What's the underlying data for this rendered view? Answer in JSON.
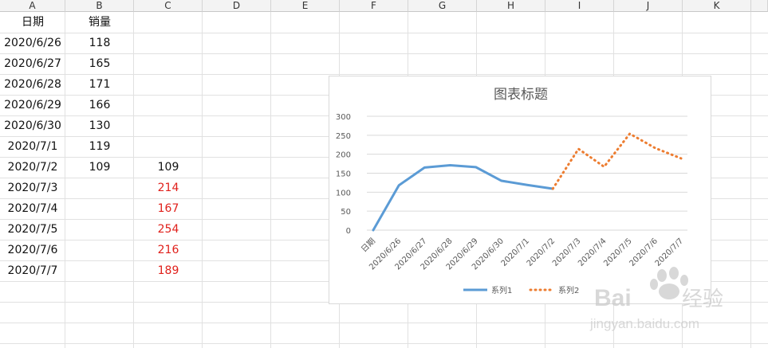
{
  "columns": [
    "A",
    "B",
    "C",
    "D",
    "E",
    "F",
    "G",
    "H",
    "I",
    "J",
    "K"
  ],
  "rows": [
    {
      "a": "日期",
      "b": "销量",
      "c": ""
    },
    {
      "a": "2020/6/26",
      "b": "118",
      "c": ""
    },
    {
      "a": "2020/6/27",
      "b": "165",
      "c": ""
    },
    {
      "a": "2020/6/28",
      "b": "171",
      "c": ""
    },
    {
      "a": "2020/6/29",
      "b": "166",
      "c": ""
    },
    {
      "a": "2020/6/30",
      "b": "130",
      "c": ""
    },
    {
      "a": "2020/7/1",
      "b": "119",
      "c": ""
    },
    {
      "a": "2020/7/2",
      "b": "109",
      "c": "109"
    },
    {
      "a": "2020/7/3",
      "b": "",
      "c": "214"
    },
    {
      "a": "2020/7/4",
      "b": "",
      "c": "167"
    },
    {
      "a": "2020/7/5",
      "b": "",
      "c": "254"
    },
    {
      "a": "2020/7/6",
      "b": "",
      "c": "216"
    },
    {
      "a": "2020/7/7",
      "b": "",
      "c": "189"
    }
  ],
  "colors": {
    "series1": "#5b9bd5",
    "series2": "#ed7d31",
    "red_text": "#e0201b"
  },
  "watermark": {
    "brand": "Bai",
    "brand2": "经验",
    "url": "jingyan.baidu.com"
  },
  "chart_data": {
    "type": "line",
    "title": "图表标题",
    "categories": [
      "日期",
      "2020/6/26",
      "2020/6/27",
      "2020/6/28",
      "2020/6/29",
      "2020/6/30",
      "2020/7/1",
      "2020/7/2",
      "2020/7/3",
      "2020/7/4",
      "2020/7/5",
      "2020/7/6",
      "2020/7/7"
    ],
    "series": [
      {
        "name": "系列1",
        "values": [
          0,
          118,
          165,
          171,
          166,
          130,
          119,
          109,
          null,
          null,
          null,
          null,
          null
        ],
        "style": "solid"
      },
      {
        "name": "系列2",
        "values": [
          null,
          null,
          null,
          null,
          null,
          null,
          null,
          109,
          214,
          167,
          254,
          216,
          189
        ],
        "style": "dotted"
      }
    ],
    "yticks": [
      "0",
      "50",
      "100",
      "150",
      "200",
      "250",
      "300"
    ],
    "ylim": [
      0,
      300
    ],
    "grid": true,
    "legend": "bottom"
  }
}
